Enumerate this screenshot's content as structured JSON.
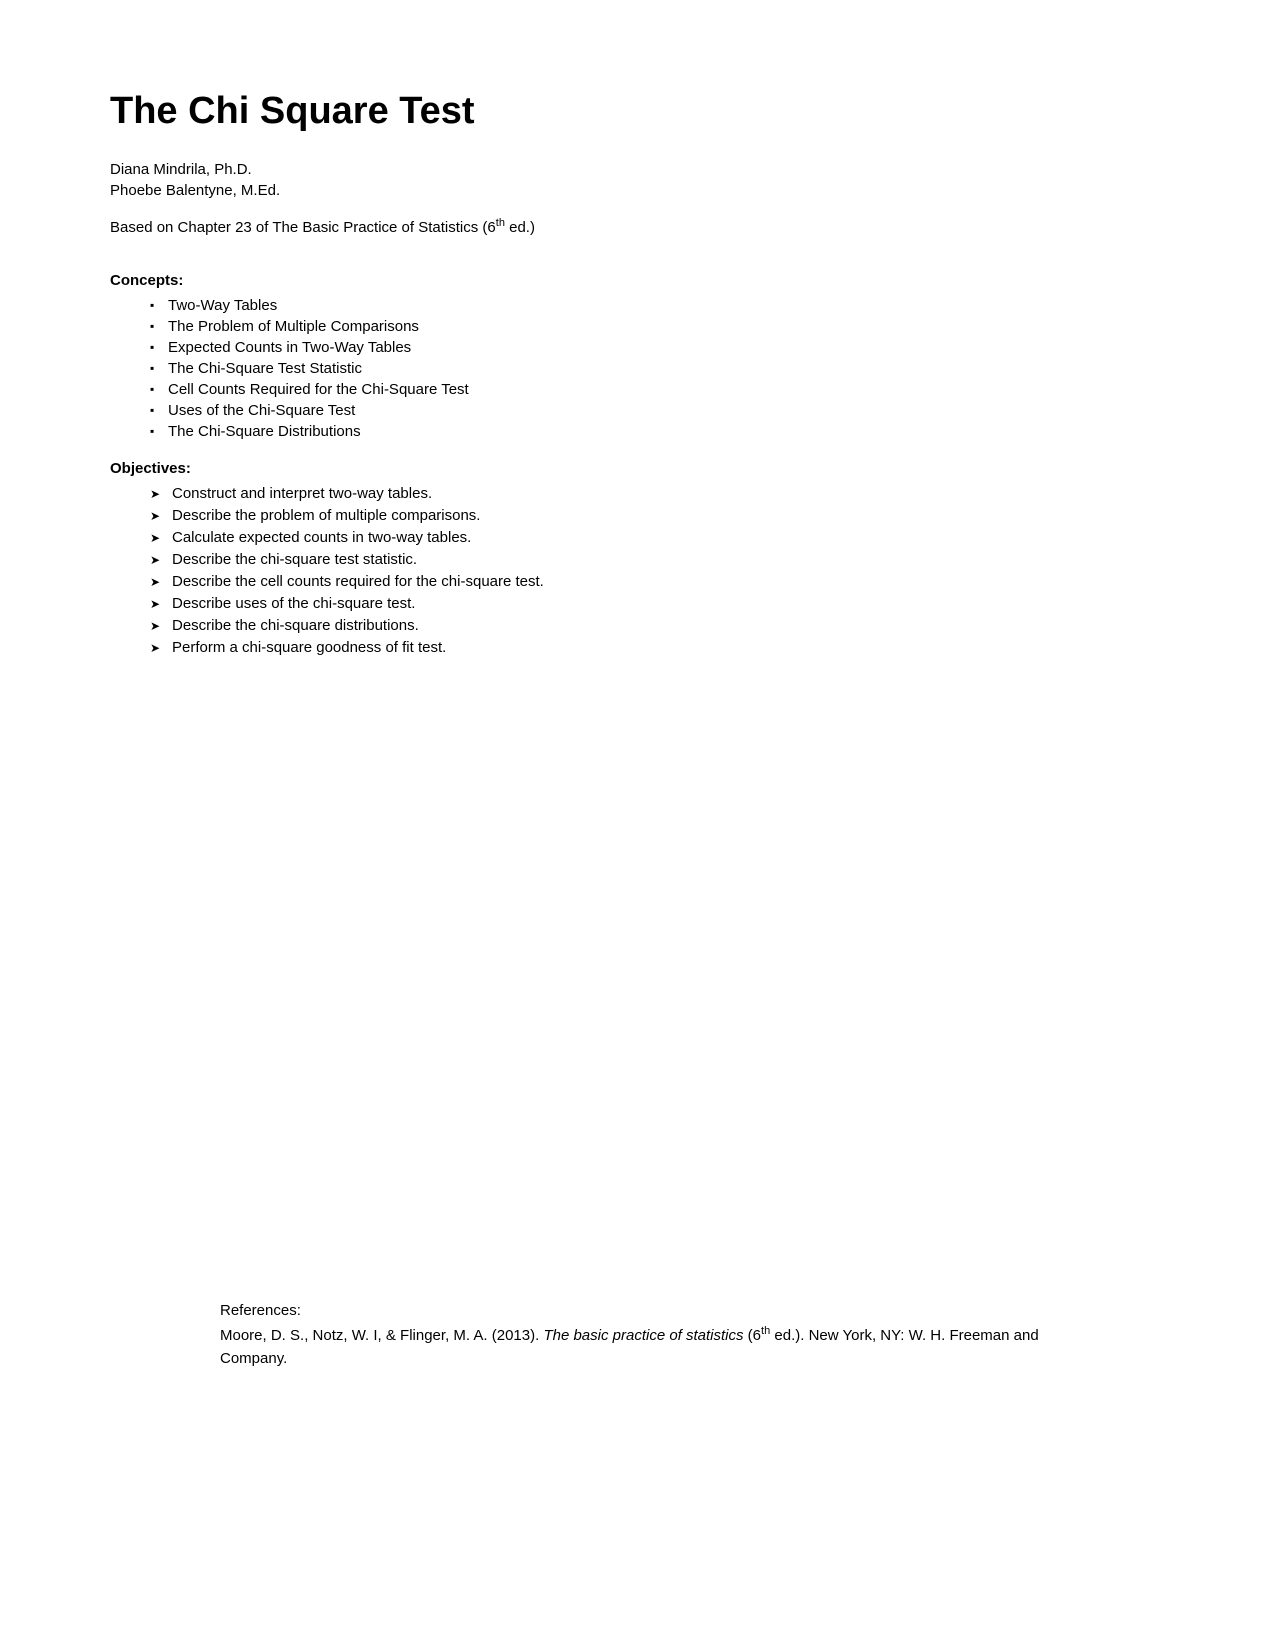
{
  "title": "The Chi Square Test",
  "authors": {
    "line1": "Diana Mindrila, Ph.D.",
    "line2": "Phoebe Balentyne, M.Ed."
  },
  "based_on": {
    "prefix": "Based on Chapter 23 of The Basic Practice of Statistics (6",
    "superscript": "th",
    "suffix": " ed.)"
  },
  "concepts": {
    "heading": "Concepts:",
    "items": [
      "Two-Way Tables",
      "The Problem of Multiple Comparisons",
      "Expected Counts in Two-Way Tables",
      "The Chi-Square Test Statistic",
      "Cell Counts Required for the Chi-Square Test",
      "Uses of the Chi-Square Test",
      "The Chi-Square Distributions"
    ]
  },
  "objectives": {
    "heading": "Objectives:",
    "items": [
      "Construct and interpret two-way tables.",
      "Describe the problem of multiple comparisons.",
      "Calculate expected counts in two-way tables.",
      "Describe the chi-square test statistic.",
      "Describe the cell counts required for the chi-square test.",
      "Describe uses of the chi-square test.",
      "Describe the chi-square distributions.",
      "Perform a chi-square goodness of fit test."
    ]
  },
  "references": {
    "label": "References:",
    "text_prefix": "Moore, D. S., Notz, W. I, & Flinger, M. A. (2013). ",
    "text_italic": "The basic practice of statistics",
    "text_suffix_pre": " (6",
    "text_superscript": "th",
    "text_suffix": " ed.). New York, NY: W. H. Freeman and Company."
  }
}
